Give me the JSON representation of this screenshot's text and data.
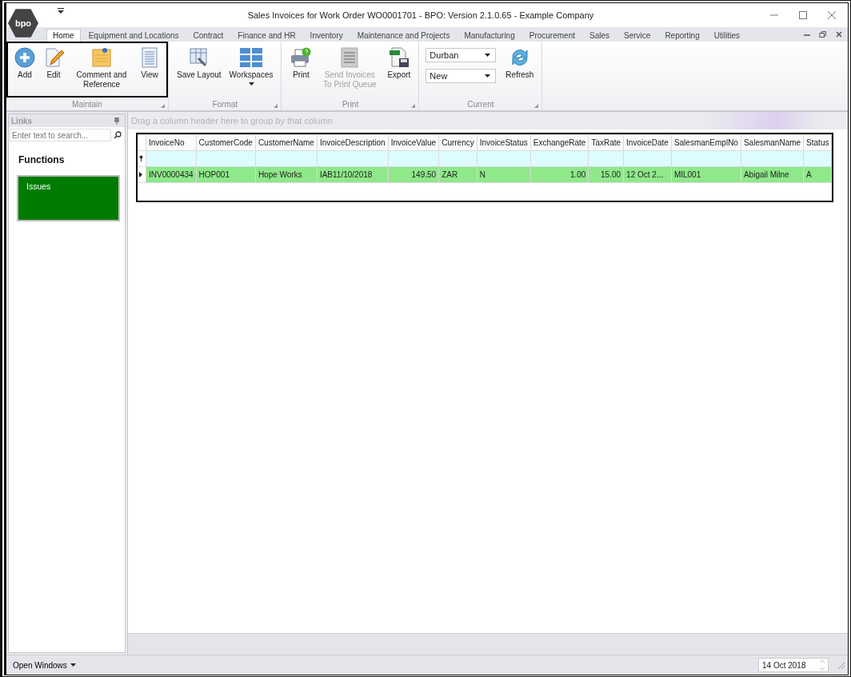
{
  "window": {
    "title": "Sales Invoices for Work Order WO0001701 - BPO: Version 2.1.0.65 - Example Company",
    "logo": "bpo"
  },
  "ribbon_tabs": [
    {
      "label": "Home",
      "selected": true
    },
    {
      "label": "Equipment and Locations",
      "selected": false
    },
    {
      "label": "Contract",
      "selected": false
    },
    {
      "label": "Finance and HR",
      "selected": false
    },
    {
      "label": "Inventory",
      "selected": false
    },
    {
      "label": "Maintenance and Projects",
      "selected": false
    },
    {
      "label": "Manufacturing",
      "selected": false
    },
    {
      "label": "Procurement",
      "selected": false
    },
    {
      "label": "Sales",
      "selected": false
    },
    {
      "label": "Service",
      "selected": false
    },
    {
      "label": "Reporting",
      "selected": false
    },
    {
      "label": "Utilities",
      "selected": false
    }
  ],
  "ribbon_groups": [
    {
      "label": "Maintain",
      "highlighted": true,
      "items": [
        {
          "kind": "add",
          "label": "Add",
          "disabled": false
        },
        {
          "kind": "edit",
          "label": "Edit",
          "disabled": false
        },
        {
          "kind": "note",
          "label": "Comment and Reference",
          "disabled": false
        },
        {
          "kind": "view",
          "label": "View",
          "disabled": false
        }
      ]
    },
    {
      "label": "Format",
      "highlighted": false,
      "items": [
        {
          "kind": "layout",
          "label": "Save Layout",
          "disabled": false
        },
        {
          "kind": "workspaces",
          "label": "Workspaces",
          "disabled": false
        }
      ]
    },
    {
      "label": "Print",
      "highlighted": false,
      "items": [
        {
          "kind": "print",
          "label": "Print",
          "disabled": false
        },
        {
          "kind": "queue",
          "label": "Send Invoices To Print Queue",
          "disabled": true
        },
        {
          "kind": "export",
          "label": "Export",
          "disabled": false
        }
      ]
    },
    {
      "label": "Current",
      "highlighted": false,
      "items": [
        {
          "kind": "dropdowns",
          "values": [
            "Durban",
            "New"
          ]
        },
        {
          "kind": "refresh",
          "label": "Refresh",
          "disabled": false
        }
      ]
    }
  ],
  "links": {
    "title": "Links",
    "search_placeholder": "Enter text to search...",
    "section": "Functions",
    "tiles": [
      {
        "label": "Issues",
        "color": "#007a00"
      }
    ]
  },
  "grid": {
    "group_hint": "Drag a column header here to group by that column",
    "highlighted": true,
    "columns": [
      {
        "label": "InvoiceNo"
      },
      {
        "label": "CustomerCode"
      },
      {
        "label": "CustomerName"
      },
      {
        "label": "InvoiceDescription"
      },
      {
        "label": "InvoiceValue"
      },
      {
        "label": "Currency"
      },
      {
        "label": "InvoiceStatus"
      },
      {
        "label": "ExchangeRate"
      },
      {
        "label": "TaxRate"
      },
      {
        "label": "InvoiceDate"
      },
      {
        "label": "SalesmanEmplNo"
      },
      {
        "label": "SalesmanName"
      },
      {
        "label": "Status"
      }
    ],
    "rows": [
      {
        "selected": true,
        "cells": [
          "INV0000434",
          "HOP001",
          "Hope Works",
          "IAB11/10/2018",
          "149.50",
          "ZAR",
          "N",
          "1.00",
          "15.00",
          "12 Oct 2...",
          "MIL001",
          "Abigail Milne",
          "A"
        ]
      }
    ]
  },
  "status_bar": {
    "open_windows": "Open Windows",
    "date": "14 Oct 2018"
  }
}
